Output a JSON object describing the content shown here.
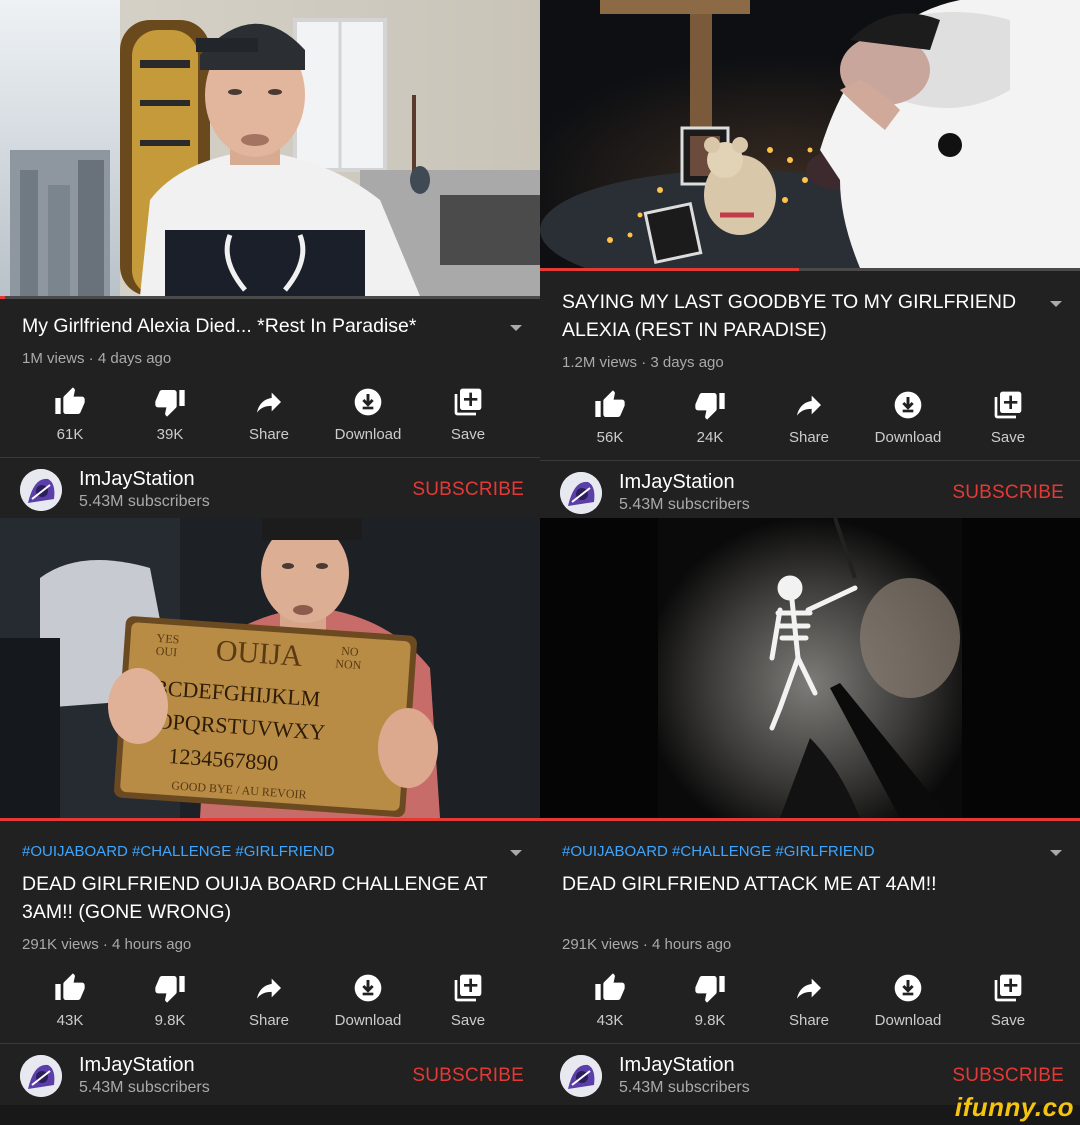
{
  "colors": {
    "accent_red": "#e53935",
    "tag_blue": "#3ea6ff",
    "panel_bg": "#212121",
    "watermark_yellow": "#f6c40f"
  },
  "panels": [
    {
      "tags": "",
      "title": "My Girlfriend Alexia Died... *Rest In Paradise*",
      "meta": "1M views · 4 days ago",
      "progress": 0.01,
      "actions": {
        "like": "61K",
        "dislike": "39K",
        "share": "Share",
        "download": "Download",
        "save": "Save"
      },
      "channel": {
        "name": "ImJayStation",
        "subs": "5.43M subscribers",
        "subscribe": "SUBSCRIBE"
      }
    },
    {
      "tags": "",
      "title": "SAYING MY LAST GOODBYE TO MY GIRLFRIEND ALEXIA (REST IN PARADISE)",
      "meta": "1.2M views · 3 days ago",
      "progress": 0.48,
      "actions": {
        "like": "56K",
        "dislike": "24K",
        "share": "Share",
        "download": "Download",
        "save": "Save"
      },
      "channel": {
        "name": "ImJayStation",
        "subs": "5.43M subscribers",
        "subscribe": "SUBSCRIBE"
      }
    },
    {
      "tags": "#OUIJABOARD #CHALLENGE #GIRLFRIEND",
      "title": "DEAD GIRLFRIEND OUIJA BOARD CHALLENGE AT 3AM!! (GONE WRONG)",
      "meta": "291K views · 4 hours ago",
      "progress": 1.0,
      "actions": {
        "like": "43K",
        "dislike": "9.8K",
        "share": "Share",
        "download": "Download",
        "save": "Save"
      },
      "channel": {
        "name": "ImJayStation",
        "subs": "5.43M subscribers",
        "subscribe": "SUBSCRIBE"
      }
    },
    {
      "tags": "#OUIJABOARD #CHALLENGE #GIRLFRIEND",
      "title": "DEAD GIRLFRIEND ATTACK ME AT 4AM!!",
      "meta": "291K views · 4 hours ago",
      "progress": 1.0,
      "actions": {
        "like": "43K",
        "dislike": "9.8K",
        "share": "Share",
        "download": "Download",
        "save": "Save"
      },
      "channel": {
        "name": "ImJayStation",
        "subs": "5.43M subscribers",
        "subscribe": "SUBSCRIBE"
      }
    }
  ],
  "thumbnails": [
    {
      "icon": "video-thumbnail-room-vlog"
    },
    {
      "icon": "video-thumbnail-memorial-candles"
    },
    {
      "icon": "video-thumbnail-ouija-board"
    },
    {
      "icon": "video-thumbnail-skeleton-night"
    }
  ],
  "ouija": {
    "top": "OUIJA",
    "yes": "YES",
    "oui": "OUI",
    "no": "NO",
    "non": "NON",
    "row1": "BCDEFGHIJKLM",
    "row2": "NOPQRSTUVWXY",
    "row3": "1234567890",
    "bottom": "GOOD BYE / AU REVOIR"
  },
  "watermark": "ifunny.co"
}
